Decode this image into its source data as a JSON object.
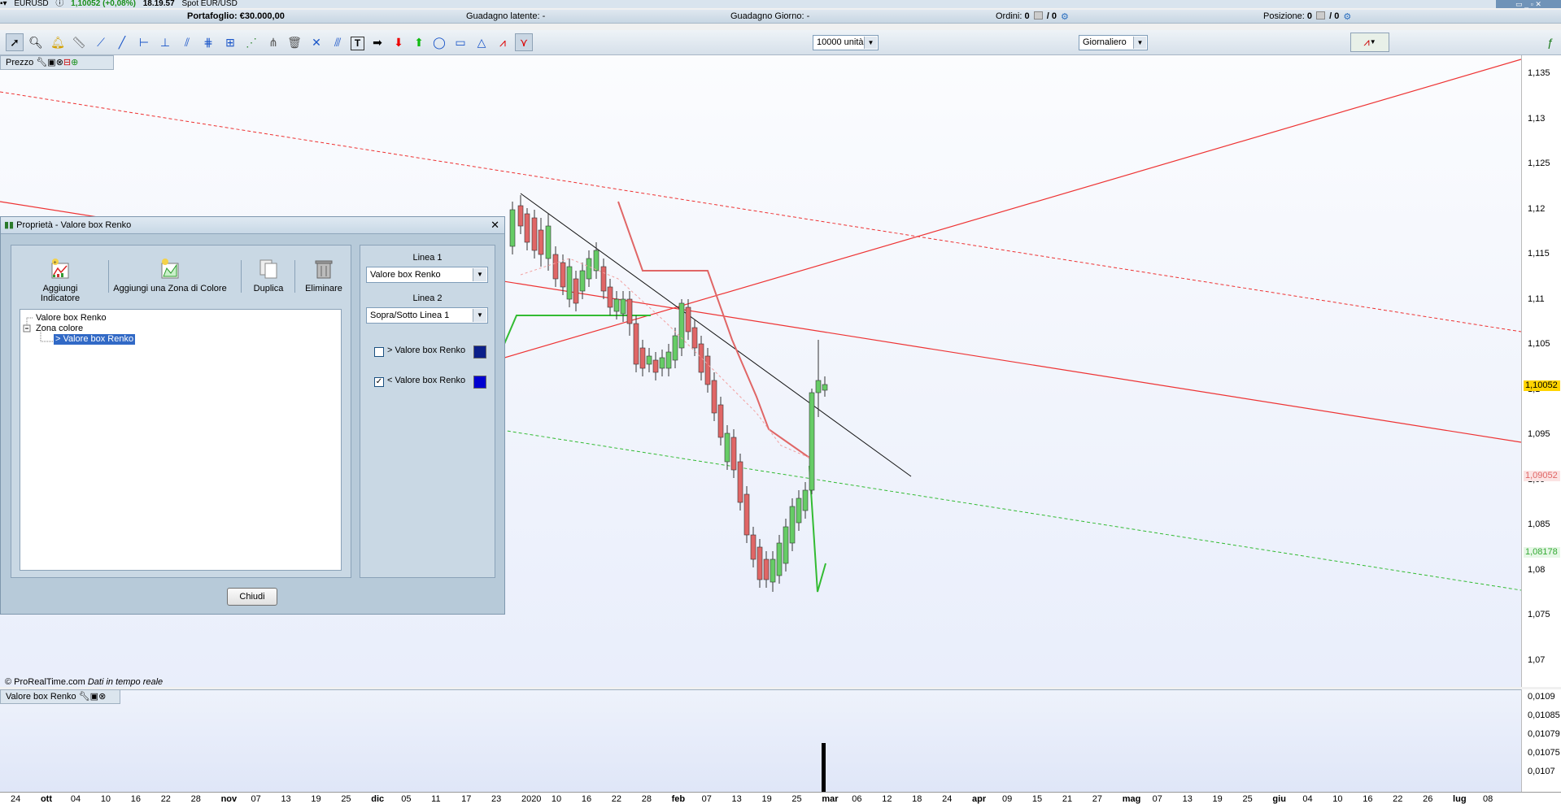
{
  "titlebar": {
    "instrument": "EURUSD",
    "price": "1,10052 (+0,08%)",
    "time": "18.19.57",
    "description": "Spot EUR/USD",
    "window_controls": "▭ _ ▫ ✕"
  },
  "infobar": {
    "portfolio": "Portafoglio: €30.000,00",
    "unrealized": "Guadagno latente:  -",
    "daily_gain": "Guadagno Giorno:  -",
    "orders_label": "Ordini:",
    "orders_count": "0",
    "orders_slash": "/ 0",
    "position_label": "Posizione:",
    "position_count": "0",
    "position_slash": "/ 0"
  },
  "toolbar": {
    "quantity": "10000 unità",
    "timeframe": "Giornaliero",
    "tools": [
      "pointer-icon",
      "zoom-icon",
      "alarm-icon",
      "ruler-icon",
      "segment-icon",
      "line-icon",
      "horizontal-line-icon",
      "vertical-line-icon",
      "channel-icon",
      "fibonacci-icon",
      "grid-icon",
      "trend-icon",
      "pitchfork-icon",
      "eraser-icon",
      "delete-icon",
      "cross-icon",
      "fan-icon",
      "text-icon",
      "arrow-right-icon",
      "arrow-down-icon",
      "arrow-up-icon",
      "ellipse-icon",
      "rectangle-icon",
      "triangle-icon",
      "zigzag-icon"
    ],
    "palette": [
      "#f3f3f3",
      "#d8d8d8",
      "#bdbdbd",
      "#9a9a9a",
      "#6e6e6e",
      "#000000",
      "#ff3b3b",
      "#ff00ff",
      "#c000c0",
      "#3b3bff",
      "#00b7ff",
      "#00e0e0",
      "#00b050",
      "#00e000",
      "#00a000"
    ]
  },
  "chart": {
    "header": "Prezzo",
    "credit_source": "© ProRealTime.com",
    "credit_note": "Dati in tempo reale",
    "colors": {
      "bull": "#66cc66",
      "bear": "#e06666",
      "resistance": "#ee3333",
      "support": "#33bb33",
      "current_tag": "#ffd400"
    },
    "price_labels": [
      "1,135",
      "1,13",
      "1,125",
      "1,12",
      "1,115",
      "1,11",
      "1,105",
      "1,1",
      "1,095",
      "1,09",
      "1,085",
      "1,08",
      "1,075",
      "1,07"
    ],
    "current_price": "1,10052",
    "tag_red": "1,09052",
    "tag_green": "1,08178"
  },
  "lower": {
    "header": "Valore box Renko",
    "labels": [
      "0,0109",
      "0,01085",
      "0,01079",
      "0,01075",
      "0,0107"
    ]
  },
  "xaxis": [
    "24",
    "ott",
    "04",
    "10",
    "16",
    "22",
    "28",
    "nov",
    "07",
    "13",
    "19",
    "25",
    "dic",
    "05",
    "11",
    "17",
    "23",
    "2020",
    "10",
    "16",
    "22",
    "28",
    "feb",
    "07",
    "13",
    "19",
    "25",
    "mar",
    "06",
    "12",
    "18",
    "24",
    "apr",
    "09",
    "15",
    "21",
    "27",
    "mag",
    "07",
    "13",
    "19",
    "25",
    "giu",
    "04",
    "10",
    "16",
    "22",
    "26",
    "lug",
    "08"
  ],
  "dialog": {
    "title": "Proprietà - Valore box Renko",
    "actions": [
      "Aggiungi Indicatore",
      "Aggiungi una Zona di Colore",
      "Duplica",
      "Eliminare"
    ],
    "tree": [
      "Valore box Renko",
      "Zona colore",
      "> Valore box Renko"
    ],
    "line1_caption": "Linea 1",
    "line1_value": "Valore box Renko",
    "line2_caption": "Linea 2",
    "line2_value": "Sopra/Sotto Linea 1",
    "opt1_label": "> Valore box Renko",
    "opt1_checked": "",
    "opt2_label": "< Valore box Renko",
    "opt2_checked": "✓",
    "opt1_color": "#0b1f8a",
    "opt2_color": "#0000d0",
    "close": "Chiudi"
  }
}
